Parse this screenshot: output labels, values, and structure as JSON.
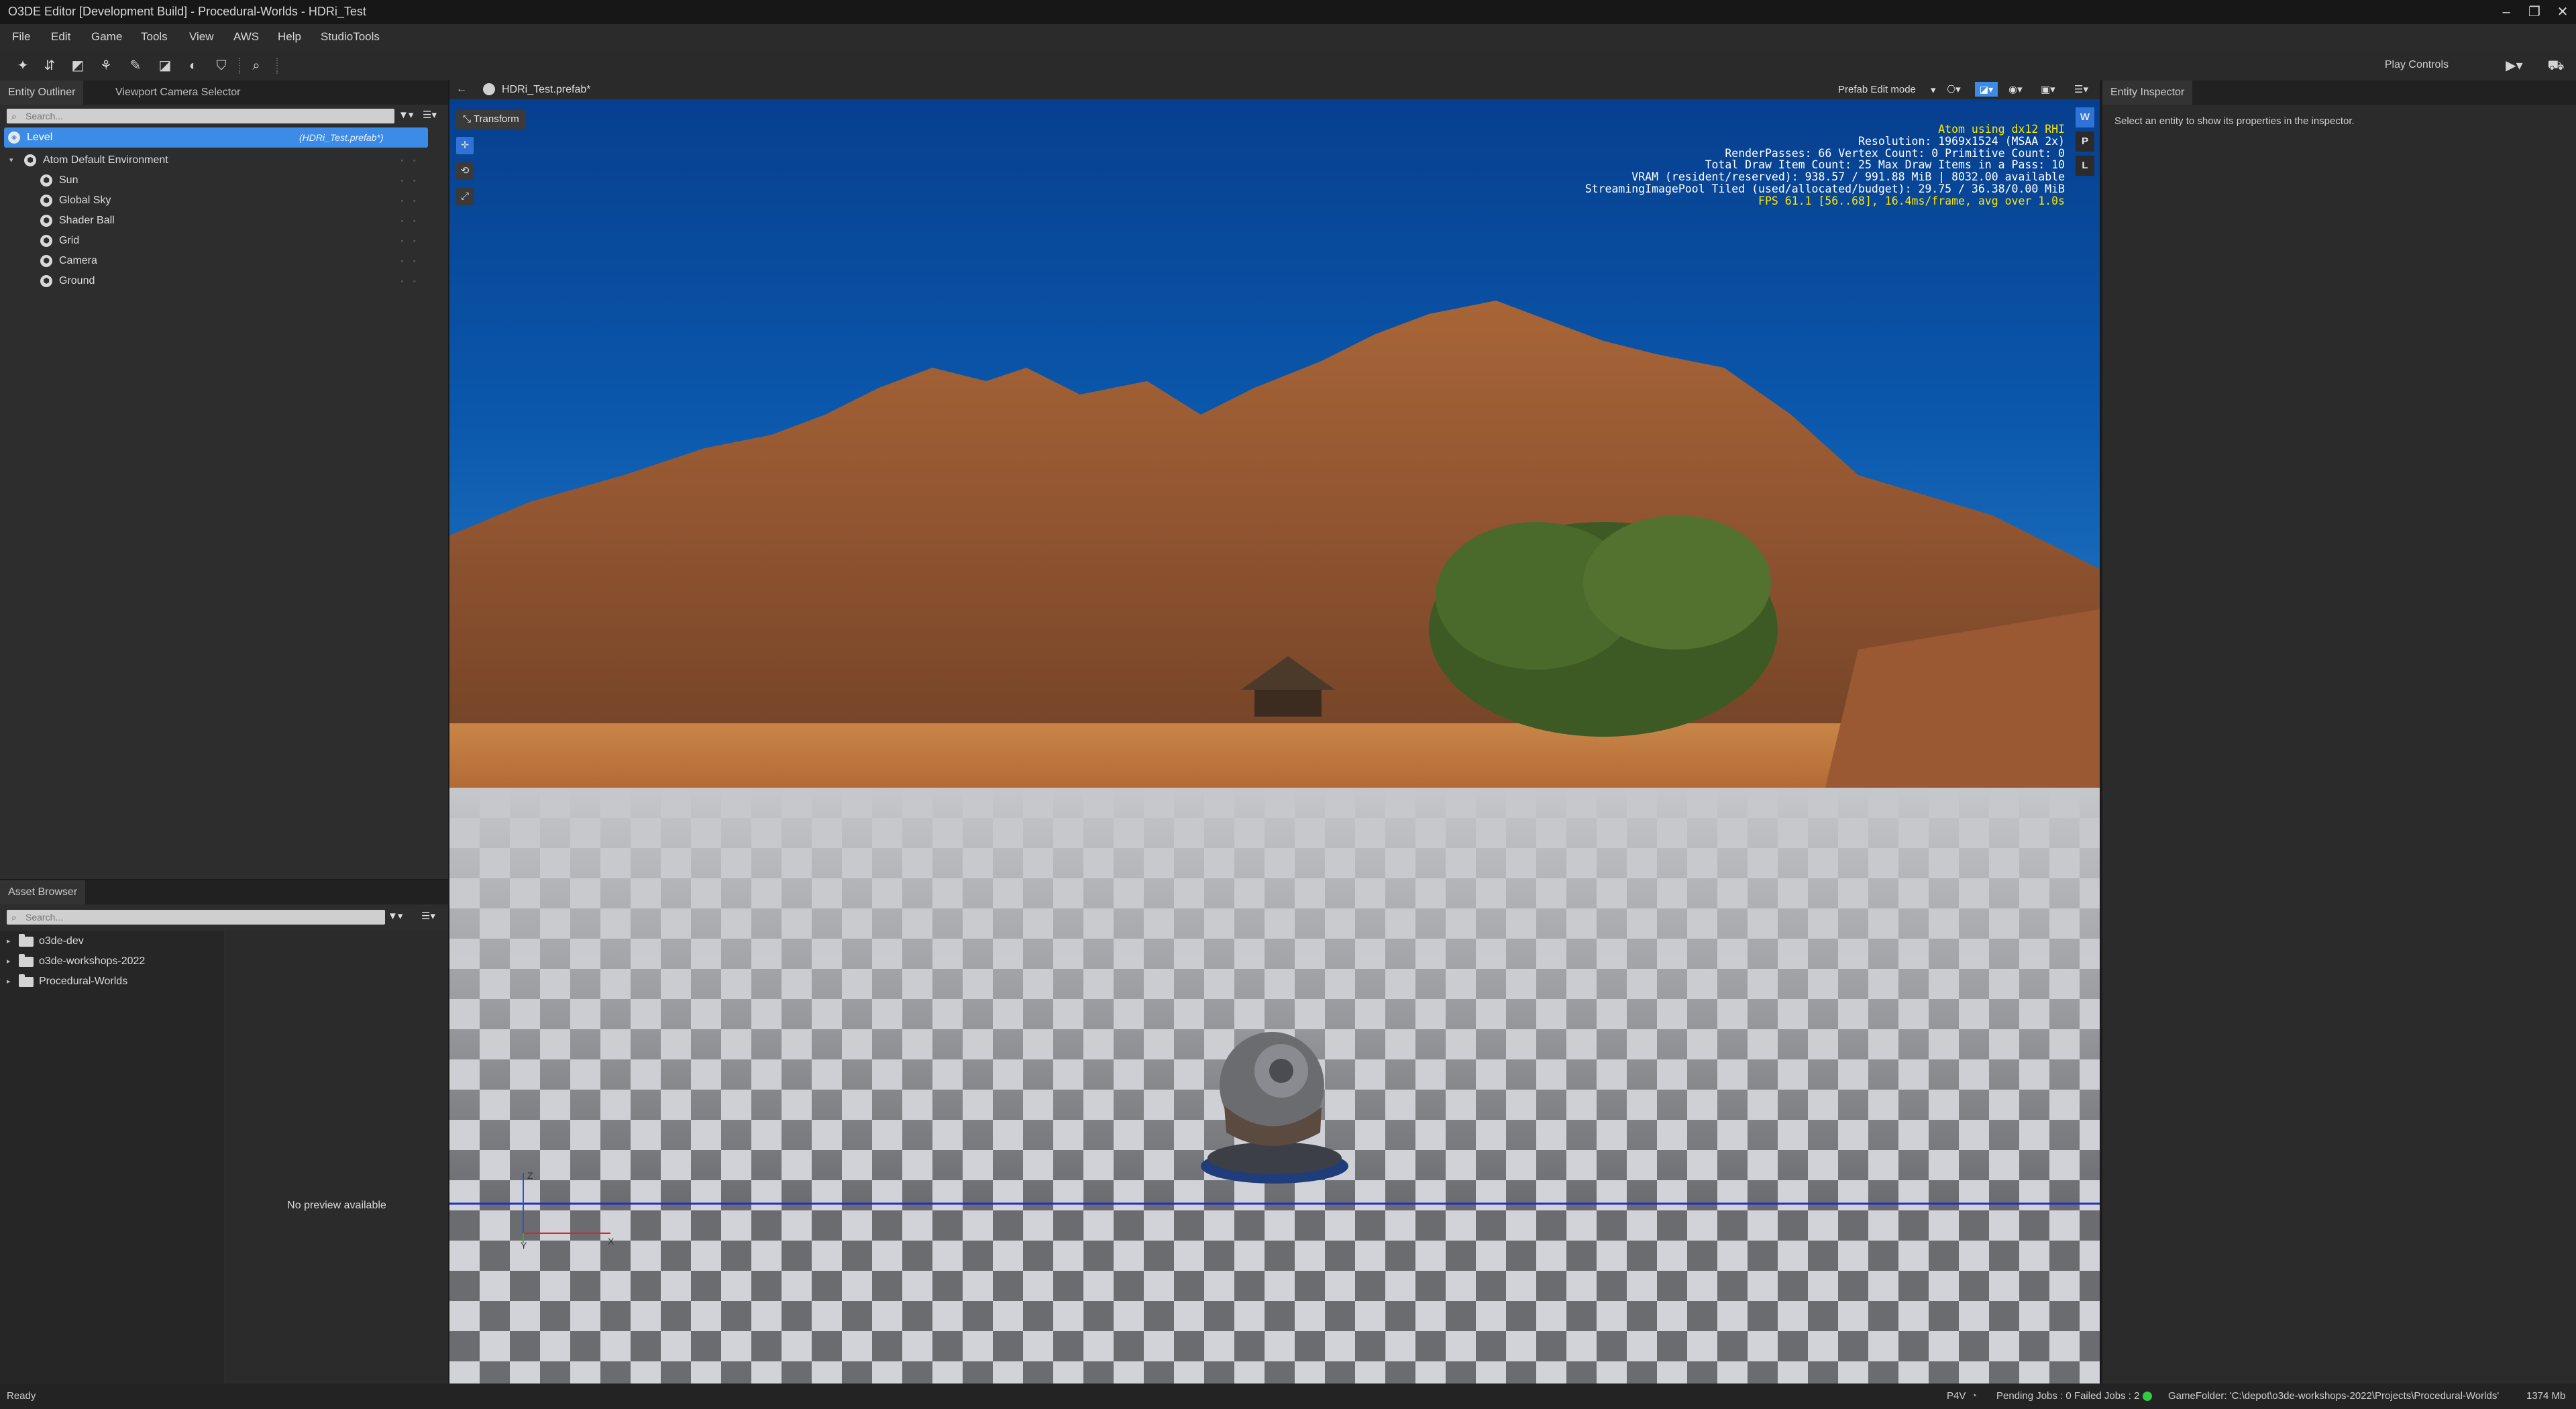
{
  "window": {
    "title": "O3DE Editor [Development Build] - Procedural-Worlds - HDRi_Test",
    "min_icon": "minimize-icon",
    "max_icon": "maximize-icon",
    "close_icon": "close-icon"
  },
  "menu": [
    "File",
    "Edit",
    "Game",
    "Tools",
    "View",
    "AWS",
    "Help",
    "StudioTools"
  ],
  "toolbar": {
    "play_controls_label": "Play Controls"
  },
  "entity_outliner": {
    "tabs": [
      "Entity Outliner",
      "Viewport Camera Selector"
    ],
    "search_placeholder": "Search...",
    "level": {
      "label": "Level",
      "prefab": "(HDRi_Test.prefab*)"
    },
    "group": "Atom Default Environment",
    "entities": [
      "Sun",
      "Global Sky",
      "Shader Ball",
      "Grid",
      "Camera",
      "Ground"
    ]
  },
  "asset_browser": {
    "tab": "Asset Browser",
    "search_placeholder": "Search...",
    "folders": [
      "o3de-dev",
      "o3de-workshops-2022",
      "Procedural-Worlds"
    ],
    "preview_text": "No preview available"
  },
  "viewport": {
    "tab_label": "HDRi_Test.prefab*",
    "mode_label": "Prefab Edit mode",
    "transform_label": "Transform",
    "stats": [
      "Atom using dx12 RHI",
      "Resolution: 1969x1524 (MSAA 2x)",
      "RenderPasses: 66 Vertex Count: 0 Primitive Count: 0",
      "Total Draw Item Count: 25  Max Draw Items in a Pass: 10",
      "VRAM (resident/reserved): 938.57 / 991.88 MiB | 8032.00 available",
      "StreamingImagePool Tiled (used/allocated/budget): 29.75 / 36.38/0.00 MiB",
      "FPS 61.1 [56..68], 16.4ms/frame, avg over 1.0s"
    ],
    "space_buttons": [
      "W",
      "P",
      "L"
    ],
    "axis_labels": {
      "z": "Z",
      "y": "Y",
      "x": "X"
    }
  },
  "inspector": {
    "tab": "Entity Inspector",
    "hint": "Select an entity to show its properties in the inspector."
  },
  "status": {
    "left": "Ready",
    "p4v": "P4V",
    "jobs": "Pending Jobs : 0  Failed Jobs : 2",
    "gamefolder": "GameFolder: 'C:\\depot\\o3de-workshops-2022\\Projects\\Procedural-Worlds'",
    "memory": "1374 Mb"
  },
  "colors": {
    "selection": "#3c8be6",
    "stats_yellow": "#ffe700",
    "status_ok": "#2ecc40"
  }
}
